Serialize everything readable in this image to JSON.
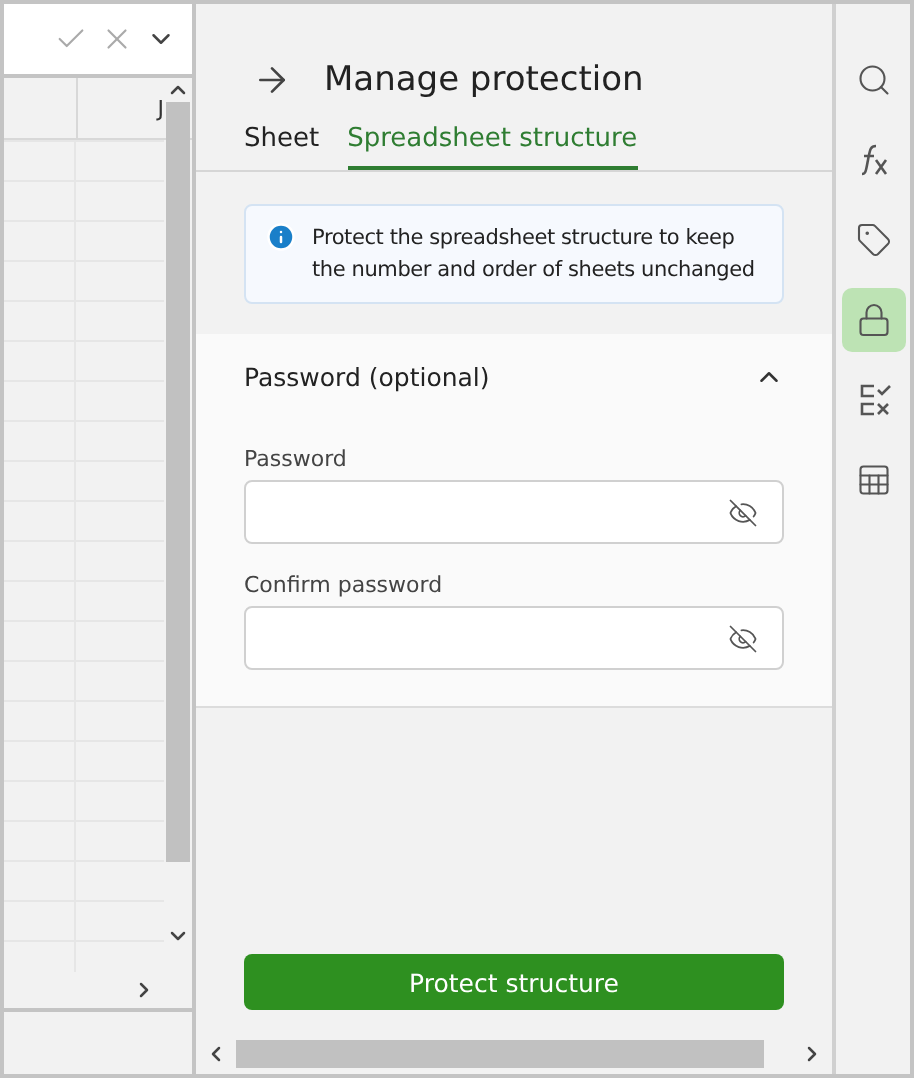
{
  "spreadsheet": {
    "column_header": "J"
  },
  "panel": {
    "title": "Manage protection",
    "tabs": [
      {
        "label": "Sheet",
        "selected": false
      },
      {
        "label": "Spreadsheet structure",
        "selected": true
      }
    ],
    "info": "Protect the spreadsheet structure to keep the number and order of sheets unchanged",
    "section": {
      "title": "Password (optional)",
      "expanded": true,
      "fields": [
        {
          "label": "Password"
        },
        {
          "label": "Confirm password"
        }
      ]
    },
    "button": "Protect structure"
  },
  "rail": [
    {
      "kind": "search",
      "selected": false
    },
    {
      "kind": "function",
      "selected": false
    },
    {
      "kind": "tag",
      "selected": false
    },
    {
      "kind": "lock",
      "selected": true
    },
    {
      "kind": "checklist",
      "selected": false
    },
    {
      "kind": "table",
      "selected": false
    }
  ]
}
